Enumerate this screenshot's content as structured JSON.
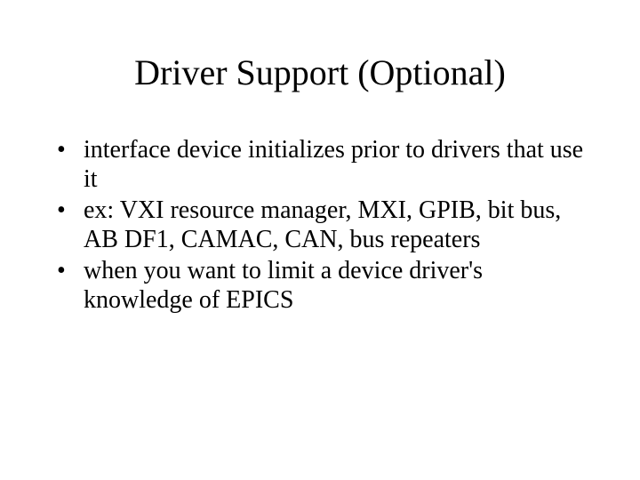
{
  "title": "Driver Support (Optional)",
  "bullets": [
    "interface device initializes prior to drivers that use it",
    "ex: VXI resource manager, MXI, GPIB, bit bus, AB DF1, CAMAC, CAN, bus repeaters",
    "when you want to limit a device driver's knowledge of EPICS"
  ]
}
